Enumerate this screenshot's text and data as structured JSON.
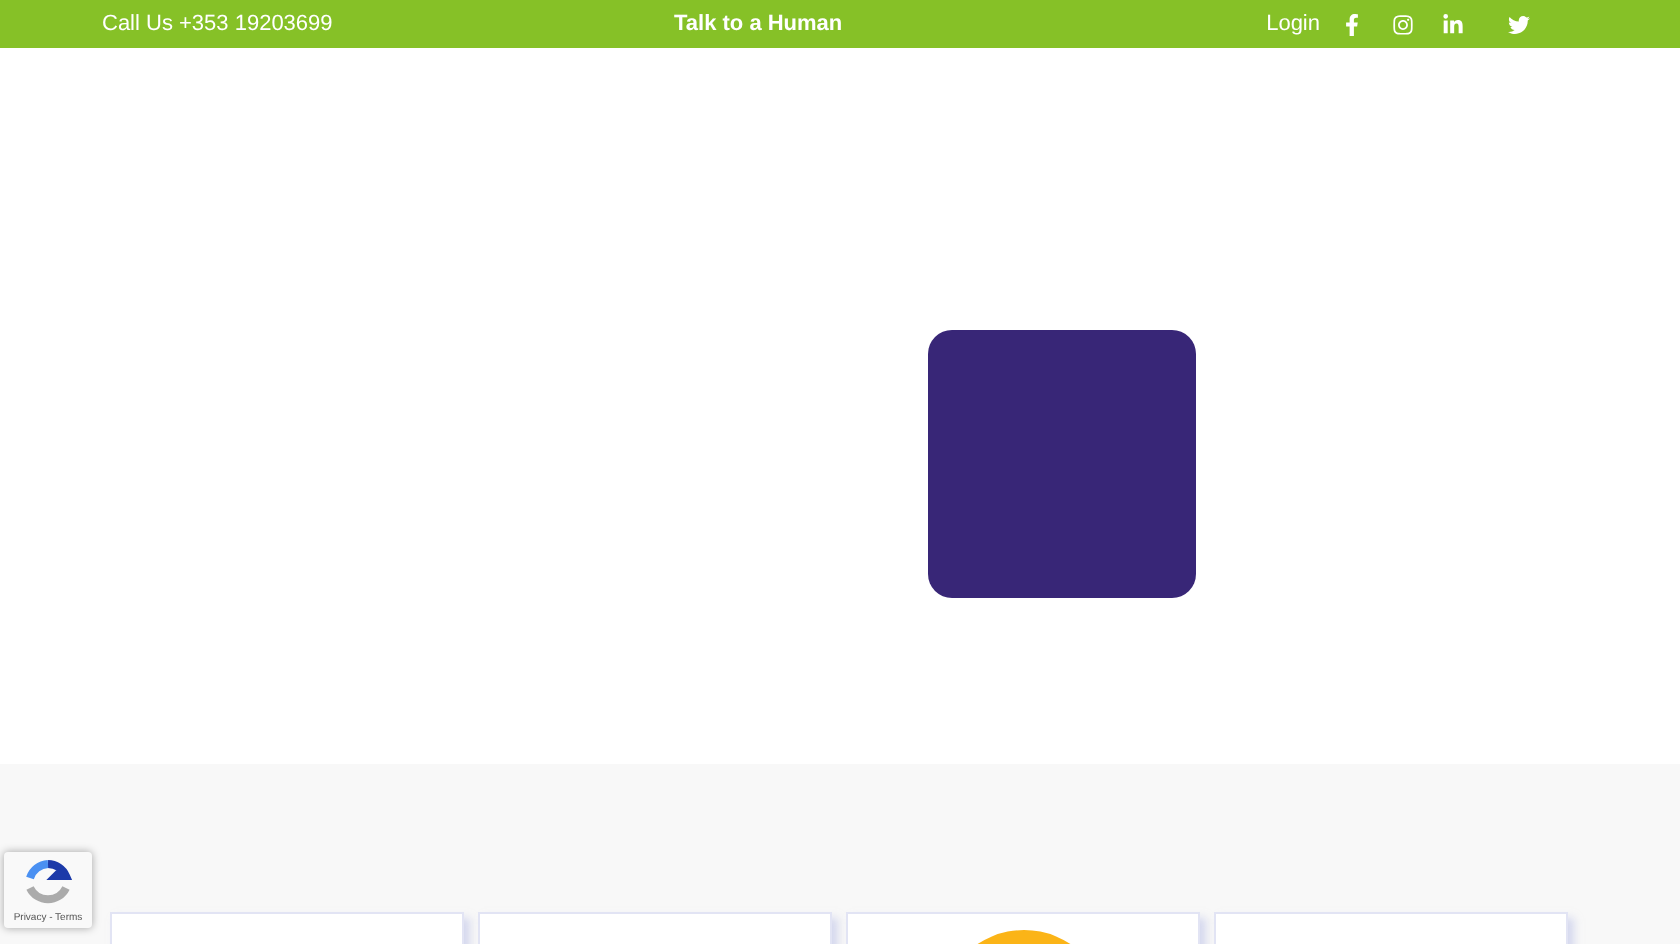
{
  "top_bar": {
    "phone": "Call Us +353 19203699",
    "center_link": "Talk to a Human",
    "login": "Login"
  },
  "recaptcha": {
    "links": "Privacy - Terms"
  }
}
